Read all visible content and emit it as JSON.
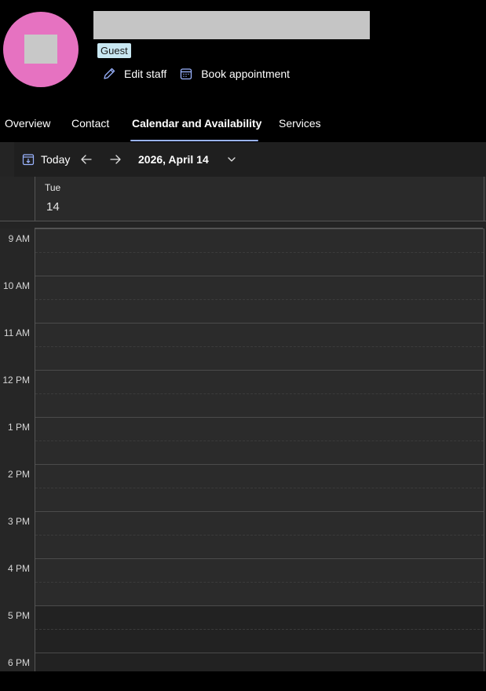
{
  "profile": {
    "badge": "Guest",
    "actions": [
      {
        "label": "Edit staff",
        "icon": "pencil-icon"
      },
      {
        "label": "Book appointment",
        "icon": "calendar-icon"
      }
    ]
  },
  "tabs": [
    {
      "label": "Overview",
      "active": false
    },
    {
      "label": "Contact",
      "active": false
    },
    {
      "label": "Calendar and Availability",
      "active": true
    },
    {
      "label": "Services",
      "active": false
    }
  ],
  "toolbar": {
    "today_label": "Today",
    "date_label": "2026, April 14"
  },
  "day": {
    "weekday": "Tue",
    "number": "14"
  },
  "time_labels": [
    "9 AM",
    "10 AM",
    "11 AM",
    "12 PM",
    "1 PM",
    "2 PM",
    "3 PM",
    "4 PM",
    "5 PM",
    "6 PM"
  ],
  "colors": {
    "accent": "#9ab3ff",
    "avatar": "#e672c1",
    "badge_bg": "#c8e7f2"
  }
}
